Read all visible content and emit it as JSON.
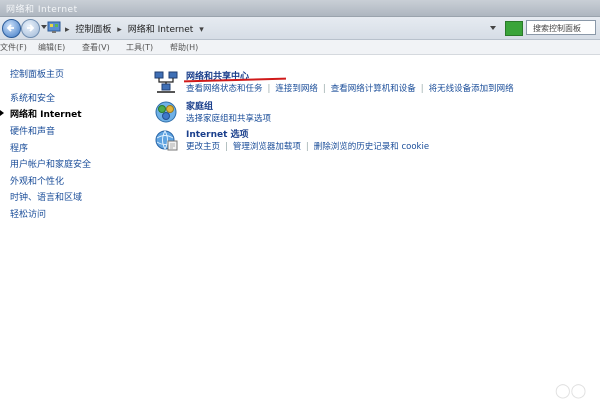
{
  "window": {
    "title": "网络和 Internet"
  },
  "address": {
    "crumbs": [
      "控制面板",
      "网络和 Internet"
    ],
    "search_placeholder": "搜索控制面板"
  },
  "menu": [
    "文件(F)",
    "编辑(E)",
    "查看(V)",
    "工具(T)",
    "帮助(H)"
  ],
  "sidebar": {
    "home": "控制面板主页",
    "items": [
      "系统和安全",
      "网络和 Internet",
      "硬件和声音",
      "程序",
      "用户帐户和家庭安全",
      "外观和个性化",
      "时钟、语言和区域",
      "轻松访问"
    ]
  },
  "categories": [
    {
      "title": "网络和共享中心",
      "tasks": [
        "查看网络状态和任务",
        "连接到网络",
        "查看网络计算机和设备",
        "将无线设备添加到网络"
      ]
    },
    {
      "title": "家庭组",
      "tasks": [
        "选择家庭组和共享选项"
      ]
    },
    {
      "title": "Internet 选项",
      "tasks": [
        "更改主页",
        "管理浏览器加载项",
        "删除浏览的历史记录和 cookie"
      ]
    }
  ],
  "accent_colors": {
    "link": "#1a4d99",
    "heading": "#1a3f8c",
    "annotation": "#d01a1a"
  }
}
